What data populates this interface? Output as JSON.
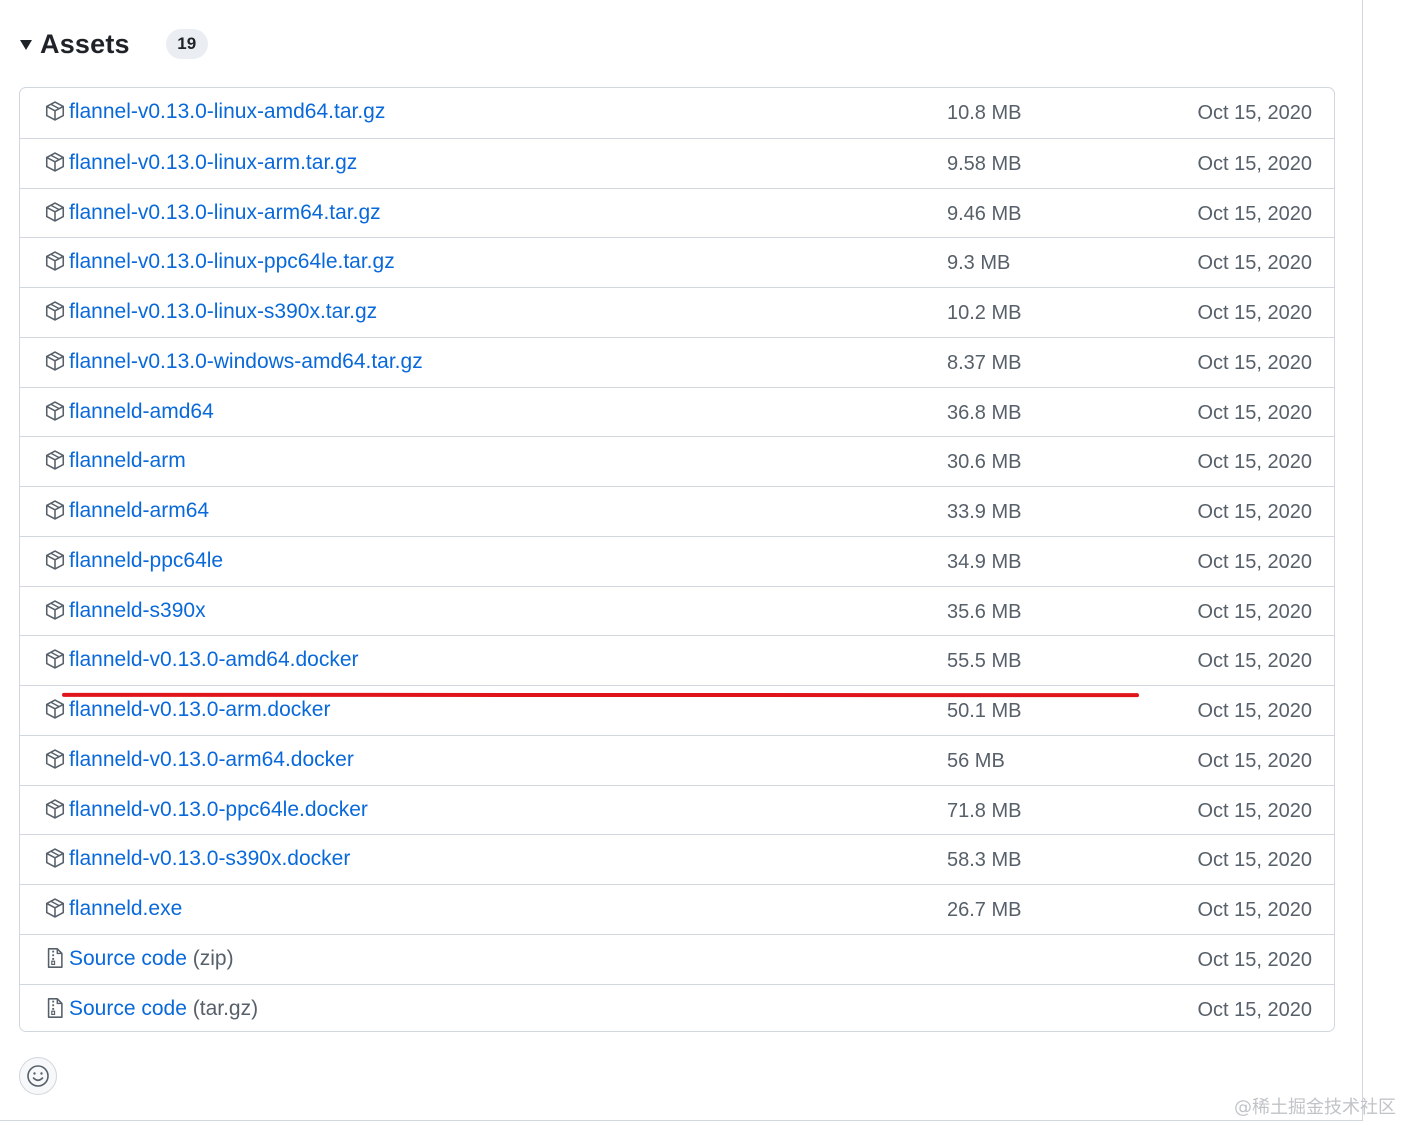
{
  "assets": {
    "title": "Assets",
    "count": "19",
    "items": [
      {
        "name": "flannel-v0.13.0-linux-amd64.tar.gz",
        "suffix": "",
        "size": "10.8 MB",
        "date": "Oct 15, 2020",
        "icon": "package-icon"
      },
      {
        "name": "flannel-v0.13.0-linux-arm.tar.gz",
        "suffix": "",
        "size": "9.58 MB",
        "date": "Oct 15, 2020",
        "icon": "package-icon"
      },
      {
        "name": "flannel-v0.13.0-linux-arm64.tar.gz",
        "suffix": "",
        "size": "9.46 MB",
        "date": "Oct 15, 2020",
        "icon": "package-icon"
      },
      {
        "name": "flannel-v0.13.0-linux-ppc64le.tar.gz",
        "suffix": "",
        "size": "9.3 MB",
        "date": "Oct 15, 2020",
        "icon": "package-icon"
      },
      {
        "name": "flannel-v0.13.0-linux-s390x.tar.gz",
        "suffix": "",
        "size": "10.2 MB",
        "date": "Oct 15, 2020",
        "icon": "package-icon"
      },
      {
        "name": "flannel-v0.13.0-windows-amd64.tar.gz",
        "suffix": "",
        "size": "8.37 MB",
        "date": "Oct 15, 2020",
        "icon": "package-icon"
      },
      {
        "name": "flanneld-amd64",
        "suffix": "",
        "size": "36.8 MB",
        "date": "Oct 15, 2020",
        "icon": "package-icon"
      },
      {
        "name": "flanneld-arm",
        "suffix": "",
        "size": "30.6 MB",
        "date": "Oct 15, 2020",
        "icon": "package-icon"
      },
      {
        "name": "flanneld-arm64",
        "suffix": "",
        "size": "33.9 MB",
        "date": "Oct 15, 2020",
        "icon": "package-icon"
      },
      {
        "name": "flanneld-ppc64le",
        "suffix": "",
        "size": "34.9 MB",
        "date": "Oct 15, 2020",
        "icon": "package-icon"
      },
      {
        "name": "flanneld-s390x",
        "suffix": "",
        "size": "35.6 MB",
        "date": "Oct 15, 2020",
        "icon": "package-icon"
      },
      {
        "name": "flanneld-v0.13.0-amd64.docker",
        "suffix": "",
        "size": "55.5 MB",
        "date": "Oct 15, 2020",
        "icon": "package-icon"
      },
      {
        "name": "flanneld-v0.13.0-arm.docker",
        "suffix": "",
        "size": "50.1 MB",
        "date": "Oct 15, 2020",
        "icon": "package-icon"
      },
      {
        "name": "flanneld-v0.13.0-arm64.docker",
        "suffix": "",
        "size": "56 MB",
        "date": "Oct 15, 2020",
        "icon": "package-icon"
      },
      {
        "name": "flanneld-v0.13.0-ppc64le.docker",
        "suffix": "",
        "size": "71.8 MB",
        "date": "Oct 15, 2020",
        "icon": "package-icon"
      },
      {
        "name": "flanneld-v0.13.0-s390x.docker",
        "suffix": "",
        "size": "58.3 MB",
        "date": "Oct 15, 2020",
        "icon": "package-icon"
      },
      {
        "name": "flanneld.exe",
        "suffix": "",
        "size": "26.7 MB",
        "date": "Oct 15, 2020",
        "icon": "package-icon"
      },
      {
        "name": "Source code",
        "suffix": " (zip)",
        "size": "",
        "date": "Oct 15, 2020",
        "icon": "file-zip-icon"
      },
      {
        "name": "Source code",
        "suffix": " (tar.gz)",
        "size": "",
        "date": "Oct 15, 2020",
        "icon": "file-zip-icon"
      }
    ]
  },
  "reaction": {
    "icon": "smiley-icon"
  },
  "annotation": {
    "color": "#e0151b"
  },
  "colors": {
    "link": "#0969da",
    "muted": "#57606a",
    "border": "#d0d7de"
  },
  "watermark": "@稀土掘金技术社区"
}
